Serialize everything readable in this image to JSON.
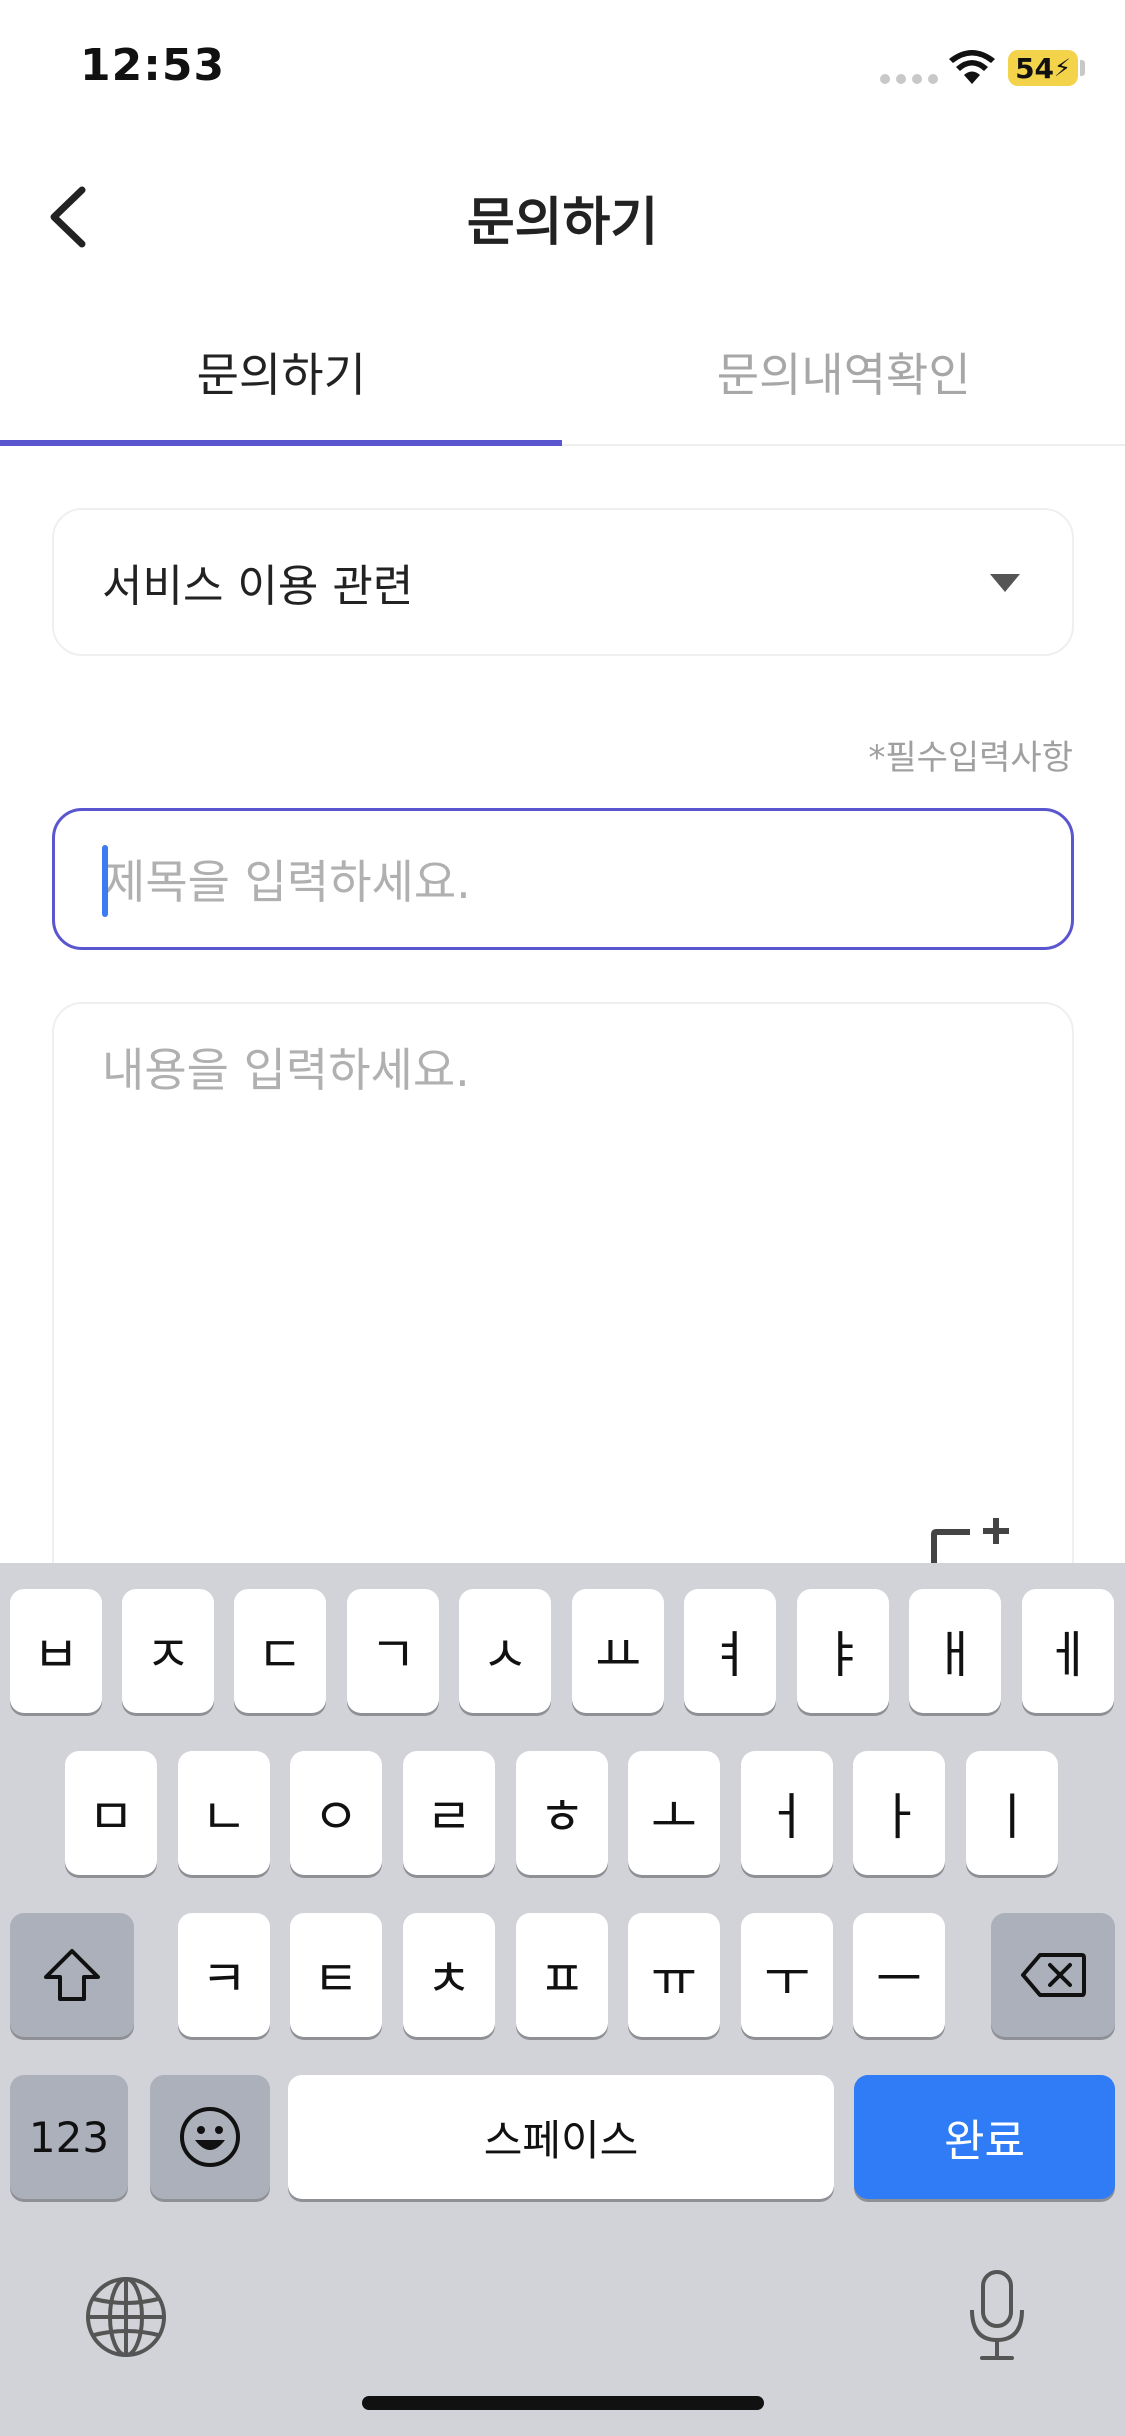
{
  "status_bar": {
    "time": "12:53",
    "battery": "54"
  },
  "header": {
    "title": "문의하기",
    "back_icon": "chevron-left-icon"
  },
  "tabs": [
    {
      "label": "문의하기",
      "active": true
    },
    {
      "label": "문의내역확인",
      "active": false
    }
  ],
  "form": {
    "category_value": "서비스 이용 관련",
    "required_note": "*필수입력사항",
    "title_placeholder": "제목을 입력하세요.",
    "content_placeholder": "내용을 입력하세요."
  },
  "keyboard": {
    "row1": [
      "ㅂ",
      "ㅈ",
      "ㄷ",
      "ㄱ",
      "ㅅ",
      "ㅛ",
      "ㅕ",
      "ㅑ",
      "ㅐ",
      "ㅔ"
    ],
    "row2": [
      "ㅁ",
      "ㄴ",
      "ㅇ",
      "ㄹ",
      "ㅎ",
      "ㅗ",
      "ㅓ",
      "ㅏ",
      "ㅣ"
    ],
    "row3": [
      "ㅋ",
      "ㅌ",
      "ㅊ",
      "ㅍ",
      "ㅠ",
      "ㅜ",
      "ㅡ"
    ],
    "numbers_label": "123",
    "space_label": "스페이스",
    "done_label": "완료"
  },
  "colors": {
    "accent": "#5a56d0",
    "keyboard_blue": "#2f7cf6"
  }
}
